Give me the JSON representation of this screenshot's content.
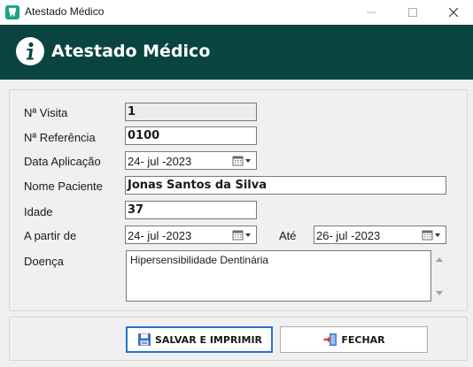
{
  "window": {
    "title": "Atestado Médico",
    "minimize_icon": "minimize-icon",
    "maximize_icon": "maximize-icon",
    "close_icon": "close-icon"
  },
  "banner": {
    "title": "Atestado Médico",
    "icon": "info-icon",
    "background": "#0a4440"
  },
  "form": {
    "visita": {
      "label": "Nª Visita",
      "value": "1"
    },
    "referencia": {
      "label": "Nª Referência",
      "value": "0100"
    },
    "data_aplicacao": {
      "label": "Data Aplicação",
      "value": "24- jul -2023"
    },
    "nome_paciente": {
      "label": "Nome Paciente",
      "value": "Jonas Santos da Silva"
    },
    "idade": {
      "label": "Idade",
      "value": "37"
    },
    "a_partir_de": {
      "label": "A partir de",
      "value": "24- jul -2023"
    },
    "ate": {
      "label": "Até",
      "value": "26- jul -2023"
    },
    "doenca": {
      "label": "Doença",
      "value": "Hipersensibilidade Dentinária"
    }
  },
  "actions": {
    "save_label": "SALVAR E IMPRIMIR",
    "close_label": "FECHAR",
    "focus_color": "#2472c8"
  }
}
